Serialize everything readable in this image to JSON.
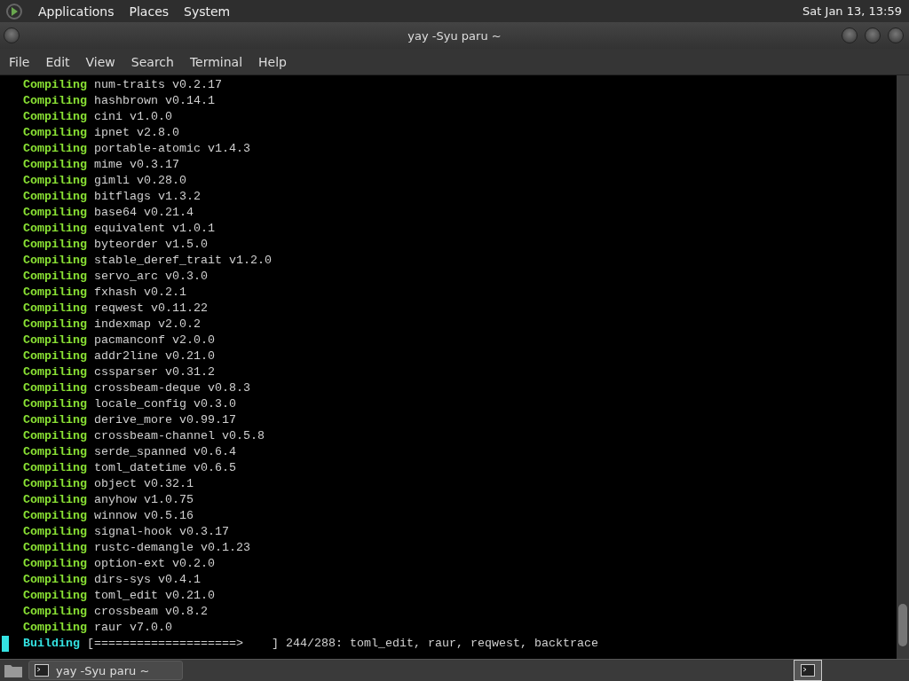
{
  "panel": {
    "menus": [
      "Applications",
      "Places",
      "System"
    ],
    "clock": "Sat Jan 13, 13:59"
  },
  "window": {
    "title": "yay -Syu paru ~"
  },
  "menubar": [
    "File",
    "Edit",
    "View",
    "Search",
    "Terminal",
    "Help"
  ],
  "terminal": {
    "lines": [
      {
        "verb": "Compiling",
        "text": "num-traits v0.2.17"
      },
      {
        "verb": "Compiling",
        "text": "hashbrown v0.14.1"
      },
      {
        "verb": "Compiling",
        "text": "cini v1.0.0"
      },
      {
        "verb": "Compiling",
        "text": "ipnet v2.8.0"
      },
      {
        "verb": "Compiling",
        "text": "portable-atomic v1.4.3"
      },
      {
        "verb": "Compiling",
        "text": "mime v0.3.17"
      },
      {
        "verb": "Compiling",
        "text": "gimli v0.28.0"
      },
      {
        "verb": "Compiling",
        "text": "bitflags v1.3.2"
      },
      {
        "verb": "Compiling",
        "text": "base64 v0.21.4"
      },
      {
        "verb": "Compiling",
        "text": "equivalent v1.0.1"
      },
      {
        "verb": "Compiling",
        "text": "byteorder v1.5.0"
      },
      {
        "verb": "Compiling",
        "text": "stable_deref_trait v1.2.0"
      },
      {
        "verb": "Compiling",
        "text": "servo_arc v0.3.0"
      },
      {
        "verb": "Compiling",
        "text": "fxhash v0.2.1"
      },
      {
        "verb": "Compiling",
        "text": "reqwest v0.11.22"
      },
      {
        "verb": "Compiling",
        "text": "indexmap v2.0.2"
      },
      {
        "verb": "Compiling",
        "text": "pacmanconf v2.0.0"
      },
      {
        "verb": "Compiling",
        "text": "addr2line v0.21.0"
      },
      {
        "verb": "Compiling",
        "text": "cssparser v0.31.2"
      },
      {
        "verb": "Compiling",
        "text": "crossbeam-deque v0.8.3"
      },
      {
        "verb": "Compiling",
        "text": "locale_config v0.3.0"
      },
      {
        "verb": "Compiling",
        "text": "derive_more v0.99.17"
      },
      {
        "verb": "Compiling",
        "text": "crossbeam-channel v0.5.8"
      },
      {
        "verb": "Compiling",
        "text": "serde_spanned v0.6.4"
      },
      {
        "verb": "Compiling",
        "text": "toml_datetime v0.6.5"
      },
      {
        "verb": "Compiling",
        "text": "object v0.32.1"
      },
      {
        "verb": "Compiling",
        "text": "anyhow v1.0.75"
      },
      {
        "verb": "Compiling",
        "text": "winnow v0.5.16"
      },
      {
        "verb": "Compiling",
        "text": "signal-hook v0.3.17"
      },
      {
        "verb": "Compiling",
        "text": "rustc-demangle v0.1.23"
      },
      {
        "verb": "Compiling",
        "text": "option-ext v0.2.0"
      },
      {
        "verb": "Compiling",
        "text": "dirs-sys v0.4.1"
      },
      {
        "verb": "Compiling",
        "text": "toml_edit v0.21.0"
      },
      {
        "verb": "Compiling",
        "text": "crossbeam v0.8.2"
      },
      {
        "verb": "Compiling",
        "text": "raur v7.0.0"
      }
    ],
    "status": {
      "verb": "Building",
      "bar": "[====================>    ]",
      "text": "244/288: toml_edit, raur, reqwest, backtrace"
    }
  },
  "taskbar": {
    "tasks": [
      {
        "label": "yay -Syu paru ~",
        "selected": false
      }
    ]
  }
}
